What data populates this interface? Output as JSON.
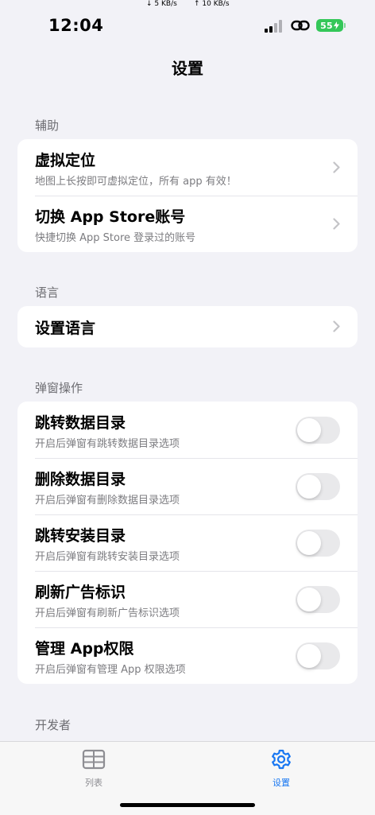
{
  "status_bar": {
    "time": "12:04",
    "download_speed": "↓ 5 KB/s",
    "upload_speed": "↑ 10 KB/s",
    "battery_level": "55",
    "battery_color": "#34c759",
    "icons": [
      "signal-icon",
      "link-icon",
      "battery-charging-icon"
    ]
  },
  "page": {
    "title": "设置"
  },
  "sections": {
    "assist": {
      "header": "辅助",
      "rows": [
        {
          "title": "虚拟定位",
          "subtitle": "地图上长按即可虚拟定位，所有 app 有效！"
        },
        {
          "title": "切换 App Store账号",
          "subtitle": "快捷切换 App Store 登录过的账号"
        }
      ]
    },
    "language": {
      "header": "语言",
      "rows": [
        {
          "title": "设置语言"
        }
      ]
    },
    "popup": {
      "header": "弹窗操作",
      "rows": [
        {
          "title": "跳转数据目录",
          "subtitle": "开启后弹窗有跳转数据目录选项",
          "enabled": false
        },
        {
          "title": "删除数据目录",
          "subtitle": "开启后弹窗有删除数据目录选项",
          "enabled": false
        },
        {
          "title": "跳转安装目录",
          "subtitle": "开启后弹窗有跳转安装目录选项",
          "enabled": false
        },
        {
          "title": "刷新广告标识",
          "subtitle": "开启后弹窗有刷新广告标识选项",
          "enabled": false
        },
        {
          "title": "管理 App权限",
          "subtitle": "开启后弹窗有管理 App 权限选项",
          "enabled": false
        }
      ]
    },
    "developer": {
      "header": "开发者"
    }
  },
  "tab_bar": {
    "items": [
      {
        "label": "列表",
        "icon": "table-list-icon",
        "selected": false
      },
      {
        "label": "设置",
        "icon": "gear-icon",
        "selected": true
      }
    ],
    "accent_color": "#1877f2",
    "inactive_color": "#8e8e93"
  }
}
